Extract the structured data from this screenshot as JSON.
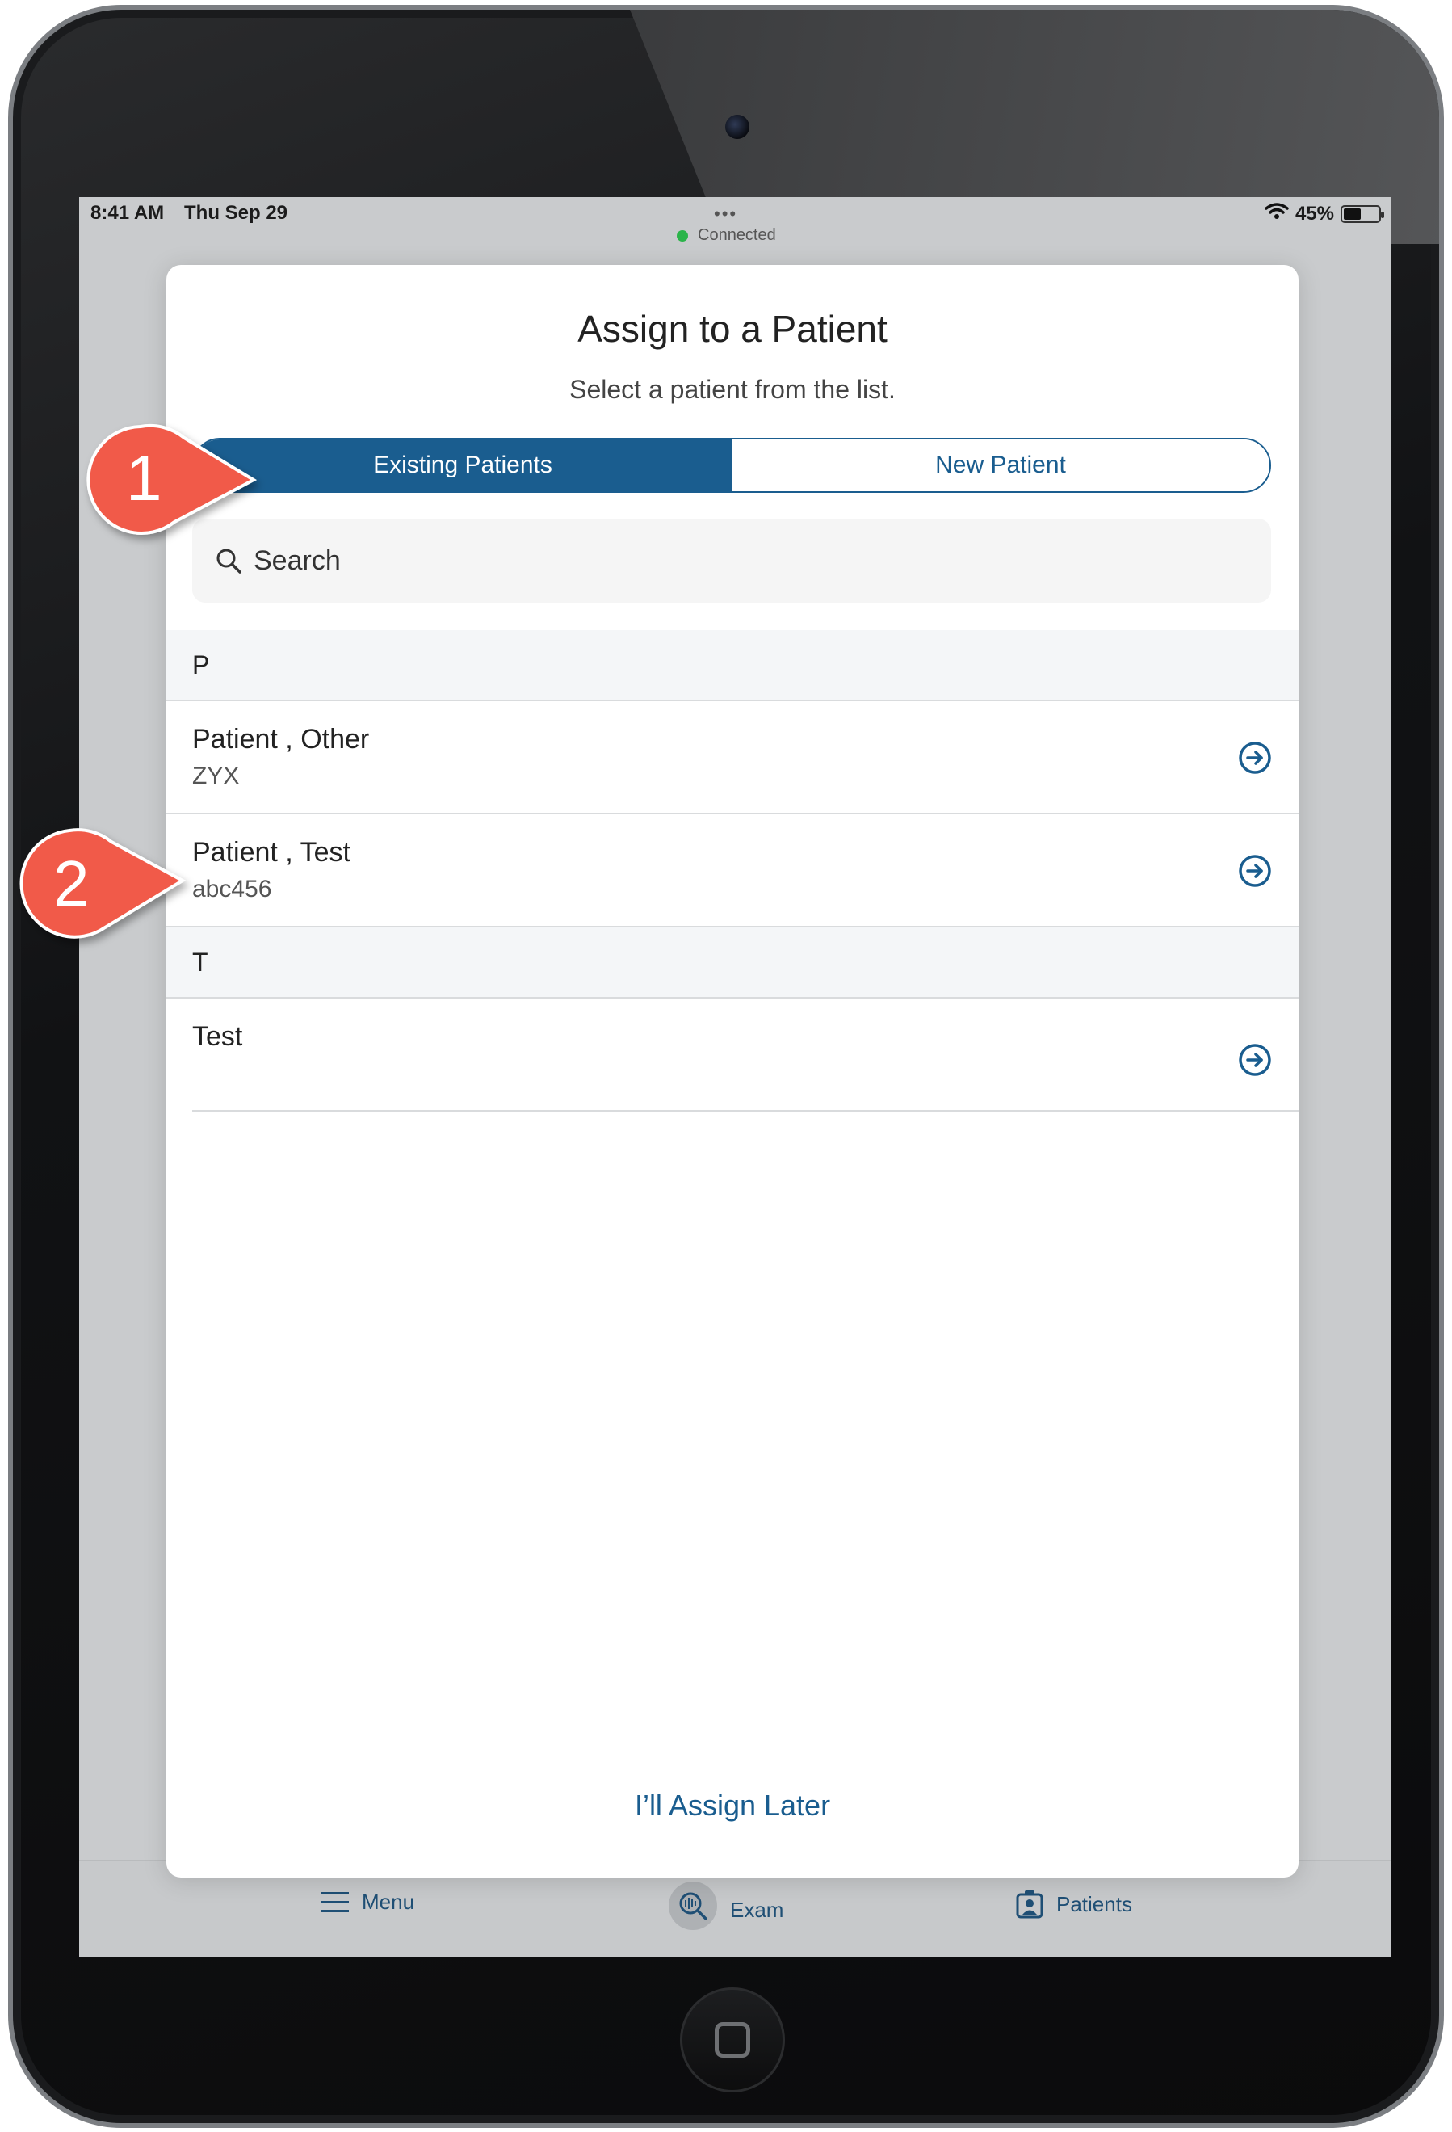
{
  "status_bar": {
    "time": "8:41 AM",
    "date": "Thu Sep 29",
    "dots": "•••",
    "connection": "Connected",
    "battery": "45%"
  },
  "modal": {
    "title": "Assign to a Patient",
    "subtitle": "Select a patient from the list.",
    "segments": {
      "existing": "Existing Patients",
      "new": "New Patient"
    },
    "search": {
      "placeholder": "Search"
    },
    "sections": [
      {
        "letter": "P",
        "rows": [
          {
            "name": "Patient , Other",
            "id": "ZYX"
          },
          {
            "name": "Patient , Test",
            "id": "abc456"
          }
        ]
      },
      {
        "letter": "T",
        "rows": [
          {
            "name": "Test",
            "id": ""
          }
        ]
      }
    ],
    "assign_later": "I’ll Assign Later"
  },
  "tab_bar": {
    "menu": "Menu",
    "exam": "Exam",
    "patients": "Patients"
  },
  "callouts": {
    "one": "1",
    "two": "2"
  },
  "colors": {
    "primary": "#1a5d8f",
    "callout": "#f15a4a",
    "connected": "#2bb44a"
  }
}
